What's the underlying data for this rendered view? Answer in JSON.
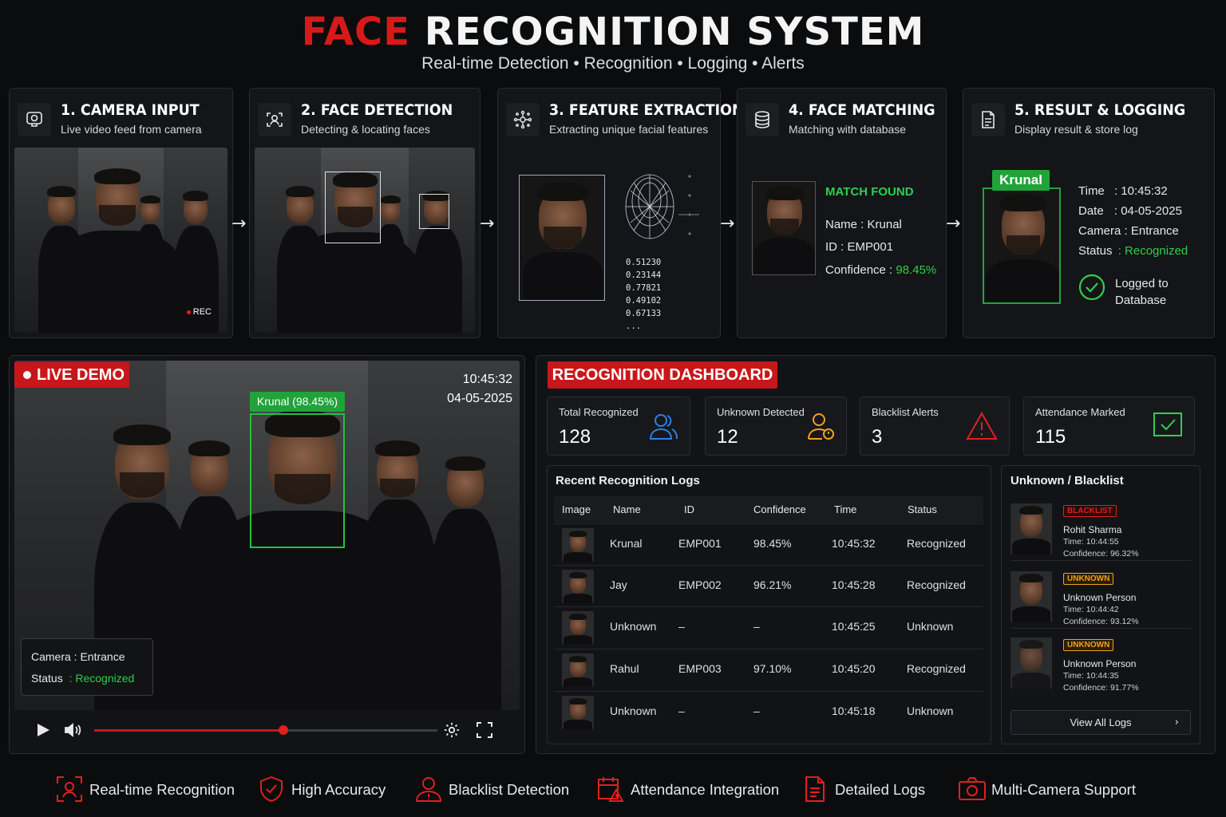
{
  "header": {
    "title_red": "FACE",
    "title_white": "RECOGNITION SYSTEM",
    "subtitle": "Real-time Detection • Recognition • Logging • Alerts"
  },
  "steps": [
    {
      "title": "1. CAMERA INPUT",
      "desc": "Live video feed from camera",
      "icon": "camera-icon"
    },
    {
      "title": "2. FACE DETECTION",
      "desc": "Detecting & locating faces",
      "icon": "face-scan-icon"
    },
    {
      "title": "3. FEATURE EXTRACTION",
      "desc": "Extracting unique facial features",
      "icon": "feature-nodes-icon"
    },
    {
      "title": "4. FACE MATCHING",
      "desc": "Matching with database",
      "icon": "database-icon"
    },
    {
      "title": "5. RESULT & LOGGING",
      "desc": "Display result & store log",
      "icon": "document-icon"
    }
  ],
  "step1": {
    "rec": "REC"
  },
  "step3": {
    "vector": [
      "0.51230",
      "0.23144",
      "0.77821",
      "0.49102",
      "0.67133",
      "..."
    ]
  },
  "step4": {
    "status": "MATCH FOUND",
    "name_label": "Name : ",
    "name": "Krunal",
    "id_label": "ID : ",
    "id": "EMP001",
    "conf_label": "Confidence : ",
    "confidence": "98.45%"
  },
  "step5": {
    "badge": "Krunal",
    "time_label": "Time",
    "time": ": 10:45:32",
    "date_label": "Date",
    "date": ": 04-05-2025",
    "camera_label": "Camera",
    "camera": ": Entrance",
    "status_label": "Status",
    "status": ": Recognized",
    "logged": "Logged to",
    "logged2": "Database"
  },
  "live": {
    "badge": "LIVE DEMO",
    "time": "10:45:32",
    "date": "04-05-2025",
    "face_label": "Krunal (98.45%)",
    "camera_label": "Camera : Entrance",
    "status_label": "Status",
    "status_value": ": Recognized",
    "progress": 0.55
  },
  "dashboard": {
    "title": "RECOGNITION DASHBOARD",
    "stats": [
      {
        "label": "Total Recognized",
        "value": "128",
        "color": "#2f7fe8",
        "icon": "users-icon"
      },
      {
        "label": "Unknown Detected",
        "value": "12",
        "color": "#f0a21a",
        "icon": "unknown-user-icon"
      },
      {
        "label": "Blacklist Alerts",
        "value": "3",
        "color": "#e0201e",
        "icon": "warning-icon"
      },
      {
        "label": "Attendance Marked",
        "value": "115",
        "color": "#2fcf4a",
        "icon": "check-box-icon"
      }
    ],
    "logs_title": "Recent Recognition Logs",
    "columns": [
      "Image",
      "Name",
      "ID",
      "Confidence",
      "Time",
      "Status"
    ],
    "rows": [
      {
        "name": "Krunal",
        "id": "EMP001",
        "confidence": "98.45%",
        "time": "10:45:32",
        "status": "Recognized"
      },
      {
        "name": "Jay",
        "id": "EMP002",
        "confidence": "96.21%",
        "time": "10:45:28",
        "status": "Recognized"
      },
      {
        "name": "Unknown",
        "id": "–",
        "confidence": "–",
        "time": "10:45:25",
        "status": "Unknown"
      },
      {
        "name": "Rahul",
        "id": "EMP003",
        "confidence": "97.10%",
        "time": "10:45:20",
        "status": "Recognized"
      },
      {
        "name": "Unknown",
        "id": "–",
        "confidence": "–",
        "time": "10:45:18",
        "status": "Unknown"
      }
    ],
    "ub_title": "Unknown / Blacklist",
    "ub_items": [
      {
        "tag": "BLACKLIST",
        "name": "Rohit Sharma",
        "time": "Time: 10:44:55",
        "confidence": "Confidence: 96.32%"
      },
      {
        "tag": "UNKNOWN",
        "name": "Unknown Person",
        "time": "Time: 10:44:42",
        "confidence": "Confidence: 93.12%"
      },
      {
        "tag": "UNKNOWN",
        "name": "Unknown Person",
        "time": "Time: 10:44:35",
        "confidence": "Confidence: 91.77%"
      }
    ],
    "view_all": "View All Logs"
  },
  "features": [
    {
      "label": "Real-time Recognition",
      "icon": "face-scan-icon"
    },
    {
      "label": "High Accuracy",
      "icon": "shield-check-icon"
    },
    {
      "label": "Blacklist Detection",
      "icon": "user-warning-icon"
    },
    {
      "label": "Attendance Integration",
      "icon": "calendar-warning-icon"
    },
    {
      "label": "Detailed Logs",
      "icon": "document-icon"
    },
    {
      "label": "Multi-Camera Support",
      "icon": "camera-icon"
    }
  ]
}
